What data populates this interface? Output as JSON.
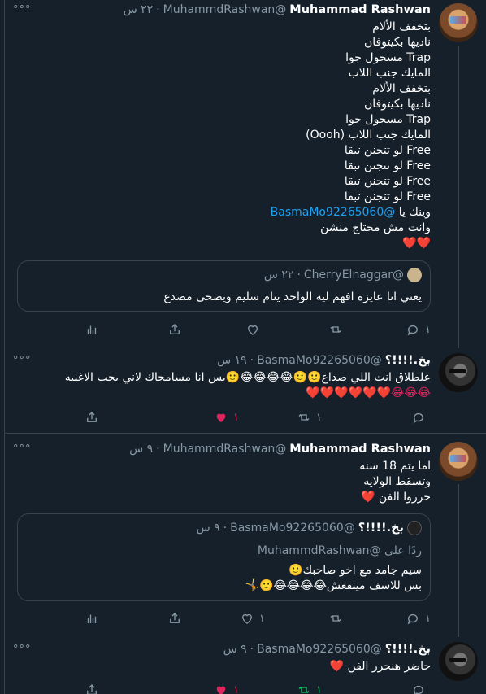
{
  "colors": {
    "background": "#15202b",
    "border": "#38444d",
    "muted": "#8899a6",
    "link": "#1da1f2",
    "like": "#e0245e",
    "retweet": "#17bf63"
  },
  "tweets": [
    {
      "name": "Muhammad Rashwan",
      "handle": "@MuhammdRashwan",
      "dot": "·",
      "time": "٢٢ س",
      "lines": [
        "بتخفف الألام",
        "ناديها بكيتوفان",
        "Trap مسحول جوا",
        "المايك جنب اللاب",
        "بتخفف الألام",
        "ناديها بكيتوفان",
        "Trap مسحول جوا",
        "المايك جنب اللاب (Oooh)",
        "Free لو تتجنن تبقا",
        "Free لو تتجنن تبقا",
        "Free لو تتجنن تبقا",
        "Free لو تتجنن تبقا"
      ],
      "mention_prefix": "وينك يا",
      "mention": "@BasmaMo92265060",
      "line_after": "وانت مش محتاج منشن",
      "hearts": "❤️❤️",
      "quote": {
        "handle": "@CherryElnaggar",
        "dot": "·",
        "time": "٢٢ س",
        "text": "يعني انا عايزة افهم ليه الواحد ينام سليم ويصحى مصدع"
      },
      "reply_count": "١",
      "retweet_count": "",
      "like_count": ""
    },
    {
      "name": "بخ.!!!!؟",
      "handle": "@BasmaMo92265060",
      "dot": "·",
      "time": "١٩ س",
      "line1": "علطلاق انت اللي صداع🙂🙂😂😂😂😂🙂بس انا مسامحاك لاني بحب الاغنيه",
      "line2": "😂😂😂❤️❤️❤️❤️❤️❤️",
      "reply_count": "",
      "retweet_count": "١",
      "like_count": "١"
    },
    {
      "name": "Muhammad Rashwan",
      "handle": "@MuhammdRashwan",
      "dot": "·",
      "time": "٩ س",
      "lines": [
        "اما يتم 18 سنه",
        "وتسقط الولايه",
        "حرروا الفن ❤️"
      ],
      "quote": {
        "name": "بخ.!!!!؟",
        "handle": "@BasmaMo92265060",
        "dot": "·",
        "time": "٩ س",
        "reply_to": "ردًا على @MuhammdRashwan",
        "text1": "سيم جامد مع اخو صاحبك🙂",
        "text2": "بس للاسف مينفعش😂😂😂😂🙂🤸"
      },
      "reply_count": "١",
      "retweet_count": "",
      "like_count": "١"
    },
    {
      "name": "بخ.!!!!؟",
      "handle": "@BasmaMo92265060",
      "dot": "·",
      "time": "٩ س",
      "line1": "حاضر هنحرر الفن ❤️",
      "reply_count": "",
      "retweet_count": "١",
      "like_count": "١"
    }
  ],
  "more_glyph": "°°°"
}
